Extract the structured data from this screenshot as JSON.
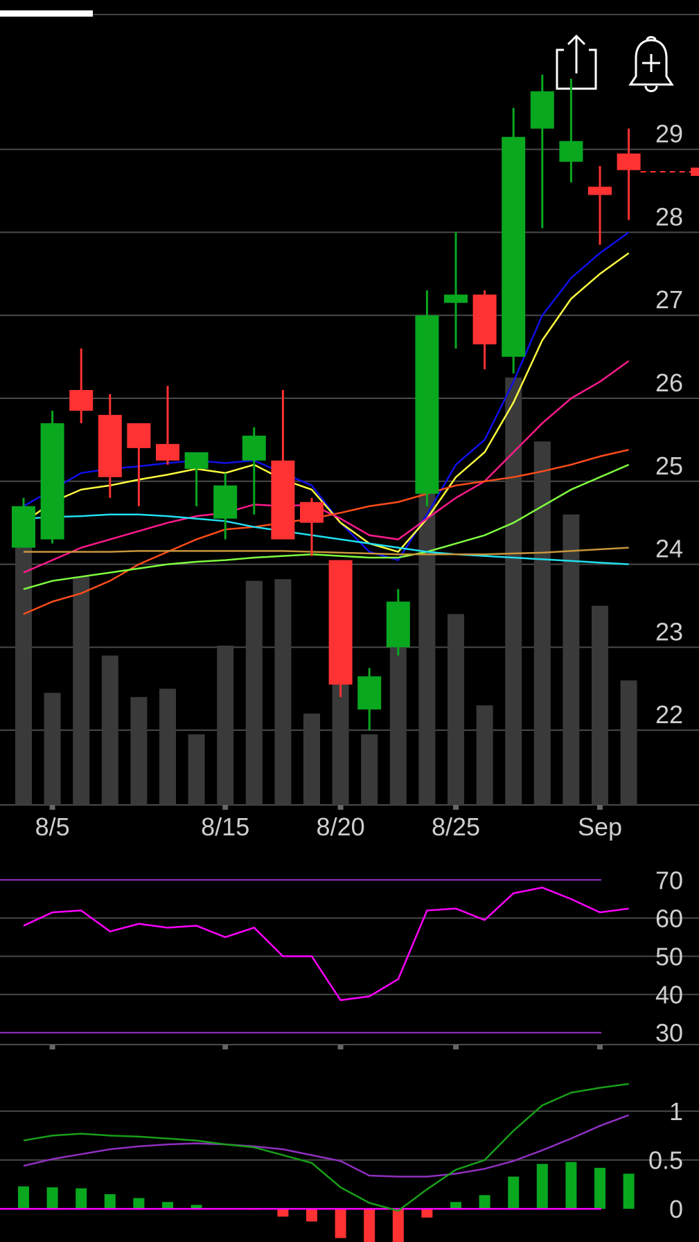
{
  "colors": {
    "background": "#000000",
    "grid": "#4a4a4a",
    "axis_text": "#cfcfcf",
    "up_candle": "#09a81f",
    "down_candle": "#fe3232",
    "volume": "#3a3a3a",
    "ma_blue": "#1010e8",
    "ma_yellow": "#ffff40",
    "ma_magenta": "#ff1a8c",
    "ma_orange": "#ff4d1a",
    "ma_green": "#80ff40",
    "ma_cyan": "#20e0f0",
    "ma_tan": "#c8963c",
    "rsi_line": "#ff00ff",
    "rsi_bounds": "#9a33cc",
    "macd_line": "#18a018",
    "signal_line": "#9030c0",
    "zero_line": "#ff00ff"
  },
  "toolbar": {
    "progress": 0.133,
    "share_icon": "share-icon",
    "alert_icon": "add-alert-bell-icon"
  },
  "chart_data": [
    {
      "type": "candlestick",
      "ylim": [
        21.1,
        30.8
      ],
      "y_ticks": [
        "22",
        "23",
        "24",
        "25",
        "26",
        "27",
        "28",
        "29"
      ],
      "x_ticks": [
        {
          "index": 1,
          "label": "8/5"
        },
        {
          "index": 7,
          "label": "8/15"
        },
        {
          "index": 11,
          "label": "8/20"
        },
        {
          "index": 15,
          "label": "8/25"
        },
        {
          "index": 20,
          "label": "Sep"
        }
      ],
      "last_price": 28.73,
      "candles": [
        {
          "o": 24.2,
          "h": 24.8,
          "l": 24.2,
          "c": 24.7
        },
        {
          "o": 24.3,
          "h": 25.85,
          "l": 24.25,
          "c": 25.7
        },
        {
          "o": 26.1,
          "h": 26.6,
          "l": 25.7,
          "c": 25.85
        },
        {
          "o": 25.8,
          "h": 26.05,
          "l": 24.8,
          "c": 25.05
        },
        {
          "o": 25.7,
          "h": 25.7,
          "l": 24.7,
          "c": 25.4
        },
        {
          "o": 25.45,
          "h": 26.15,
          "l": 25.2,
          "c": 25.25
        },
        {
          "o": 25.15,
          "h": 25.35,
          "l": 24.7,
          "c": 25.35
        },
        {
          "o": 24.55,
          "h": 25.1,
          "l": 24.3,
          "c": 24.95
        },
        {
          "o": 25.25,
          "h": 25.65,
          "l": 24.6,
          "c": 25.55
        },
        {
          "o": 25.25,
          "h": 26.1,
          "l": 24.45,
          "c": 24.3
        },
        {
          "o": 24.75,
          "h": 24.8,
          "l": 24.1,
          "c": 24.5
        },
        {
          "o": 24.05,
          "h": 24.05,
          "l": 22.4,
          "c": 22.55
        },
        {
          "o": 22.25,
          "h": 22.75,
          "l": 22.0,
          "c": 22.65
        },
        {
          "o": 23.0,
          "h": 23.7,
          "l": 22.9,
          "c": 23.55
        },
        {
          "o": 24.85,
          "h": 27.3,
          "l": 24.7,
          "c": 27.0
        },
        {
          "o": 27.15,
          "h": 28.0,
          "l": 26.6,
          "c": 27.25
        },
        {
          "o": 27.25,
          "h": 27.3,
          "l": 26.35,
          "c": 26.65
        },
        {
          "o": 26.5,
          "h": 29.5,
          "l": 26.3,
          "c": 29.15
        },
        {
          "o": 29.25,
          "h": 29.9,
          "l": 28.05,
          "c": 29.7
        },
        {
          "o": 28.85,
          "h": 29.85,
          "l": 28.6,
          "c": 29.1
        },
        {
          "o": 28.55,
          "h": 28.8,
          "l": 27.85,
          "c": 28.45
        },
        {
          "o": 28.95,
          "h": 29.25,
          "l": 28.15,
          "c": 28.75
        }
      ],
      "volumes": [
        24.25,
        22.45,
        23.85,
        22.9,
        22.4,
        22.5,
        21.95,
        23.02,
        23.8,
        23.82,
        22.2,
        22.95,
        21.95,
        23.0,
        25.0,
        23.4,
        22.3,
        26.25,
        25.48,
        24.6,
        23.5,
        22.6
      ],
      "moving_averages": [
        {
          "color_key": "ma_blue",
          "values": [
            24.7,
            24.9,
            25.1,
            25.15,
            25.18,
            25.22,
            25.25,
            25.22,
            25.25,
            25.1,
            24.95,
            24.5,
            24.15,
            24.05,
            24.6,
            25.2,
            25.5,
            26.2,
            27.0,
            27.45,
            27.75,
            28.0
          ]
        },
        {
          "color_key": "ma_yellow",
          "values": [
            24.5,
            24.75,
            24.9,
            24.95,
            25.02,
            25.08,
            25.15,
            25.1,
            25.2,
            25.02,
            24.9,
            24.5,
            24.25,
            24.15,
            24.55,
            25.05,
            25.35,
            25.95,
            26.7,
            27.2,
            27.5,
            27.75
          ]
        },
        {
          "color_key": "ma_magenta",
          "values": [
            23.9,
            24.05,
            24.2,
            24.3,
            24.4,
            24.5,
            24.58,
            24.62,
            24.72,
            24.7,
            24.72,
            24.55,
            24.35,
            24.3,
            24.55,
            24.8,
            25.0,
            25.35,
            25.7,
            26.0,
            26.2,
            26.45
          ]
        },
        {
          "color_key": "ma_orange",
          "values": [
            23.4,
            23.55,
            23.65,
            23.8,
            24.0,
            24.15,
            24.3,
            24.42,
            24.45,
            24.5,
            24.55,
            24.62,
            24.7,
            24.75,
            24.85,
            24.95,
            25.0,
            25.05,
            25.12,
            25.2,
            25.3,
            25.38
          ]
        },
        {
          "color_key": "ma_green",
          "values": [
            23.7,
            23.8,
            23.85,
            23.9,
            23.95,
            24.0,
            24.03,
            24.05,
            24.08,
            24.1,
            24.12,
            24.1,
            24.08,
            24.08,
            24.15,
            24.25,
            24.35,
            24.5,
            24.7,
            24.9,
            25.05,
            25.2
          ]
        },
        {
          "color_key": "ma_cyan",
          "values": [
            24.55,
            24.57,
            24.58,
            24.6,
            24.6,
            24.58,
            24.55,
            24.52,
            24.45,
            24.4,
            24.35,
            24.3,
            24.25,
            24.2,
            24.15,
            24.12,
            24.1,
            24.08,
            24.06,
            24.04,
            24.02,
            24.0
          ]
        },
        {
          "color_key": "ma_tan",
          "values": [
            24.15,
            24.15,
            24.15,
            24.15,
            24.16,
            24.16,
            24.16,
            24.16,
            24.16,
            24.16,
            24.15,
            24.14,
            24.13,
            24.12,
            24.12,
            24.12,
            24.12,
            24.13,
            24.14,
            24.16,
            24.18,
            24.2
          ]
        }
      ]
    },
    {
      "type": "line",
      "name": "RSI",
      "ylim": [
        26.5,
        75.5
      ],
      "y_ticks": [
        "30",
        "40",
        "50",
        "60",
        "70"
      ],
      "bounds": [
        30,
        70
      ],
      "values": [
        58,
        61.5,
        62,
        56.5,
        58.5,
        57.5,
        58,
        55,
        57.5,
        50,
        50,
        38.5,
        39.5,
        44,
        62,
        62.5,
        59.5,
        66.5,
        68,
        65,
        61.5,
        62.5
      ]
    },
    {
      "type": "bar",
      "name": "MACD",
      "ylim": [
        -0.34,
        1.42
      ],
      "y_ticks": [
        "0",
        "0.5",
        "1"
      ],
      "macd": [
        0.7,
        0.75,
        0.77,
        0.75,
        0.74,
        0.72,
        0.7,
        0.66,
        0.63,
        0.55,
        0.47,
        0.22,
        0.06,
        -0.02,
        0.2,
        0.4,
        0.5,
        0.8,
        1.06,
        1.19,
        1.24,
        1.28
      ],
      "signal": [
        0.44,
        0.51,
        0.56,
        0.61,
        0.64,
        0.66,
        0.67,
        0.66,
        0.64,
        0.61,
        0.55,
        0.49,
        0.34,
        0.33,
        0.33,
        0.36,
        0.41,
        0.49,
        0.6,
        0.72,
        0.85,
        0.96
      ],
      "histogram": [
        0.23,
        0.22,
        0.21,
        0.15,
        0.11,
        0.07,
        0.04,
        0.0,
        -0.01,
        -0.08,
        -0.13,
        -0.3,
        -0.37,
        -0.35,
        -0.09,
        0.07,
        0.14,
        0.33,
        0.46,
        0.48,
        0.42,
        0.36
      ]
    }
  ]
}
